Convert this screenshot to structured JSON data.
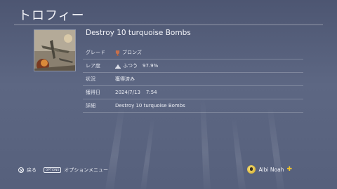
{
  "header": {
    "title": "トロフィー"
  },
  "trophy": {
    "name": "Destroy 10 turquoise Bombs",
    "thumbnail_icon": "airplane-battle-artwork"
  },
  "details": {
    "grade": {
      "label": "グレード",
      "value": "ブロンズ",
      "icon": "bronze-trophy-icon"
    },
    "rarity": {
      "label": "レア度",
      "value": "ふつう",
      "percent": "97.9%",
      "icon": "rarity-icon"
    },
    "status": {
      "label": "状況",
      "value": "獲得済み"
    },
    "earned": {
      "label": "獲得日",
      "date": "2024/7/13",
      "time": "7:54"
    },
    "description": {
      "label": "詳細",
      "value": "Destroy 10 turquoise Bombs"
    }
  },
  "footer": {
    "back_label": "戻る",
    "options_badge": "OPTIONS",
    "options_label": "オプションメニュー",
    "user_name": "Albi Noah",
    "plus_icon": "ps-plus-icon"
  },
  "colors": {
    "background": "#56607c",
    "bronze": "#c8704a",
    "plus": "#f2c62c"
  }
}
